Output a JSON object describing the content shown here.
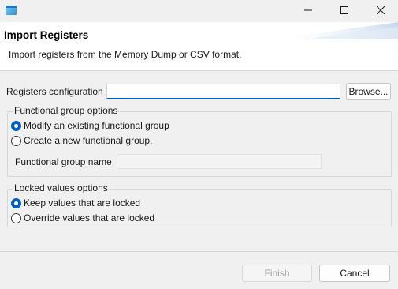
{
  "window": {
    "minimize_icon": "minimize-icon",
    "maximize_icon": "maximize-icon",
    "close_icon": "close-icon",
    "app_icon": "app-window-icon"
  },
  "banner": {
    "title": "Import Registers",
    "description": "Import registers from the Memory Dump or CSV format."
  },
  "config": {
    "label": "Registers configuration",
    "value": "",
    "browse_label": "Browse..."
  },
  "functional_group": {
    "legend": "Functional group options",
    "options": [
      {
        "label": "Modify an existing functional group",
        "checked": true
      },
      {
        "label": "Create a new functional group.",
        "checked": false
      }
    ],
    "name_label": "Functional group name",
    "name_value": ""
  },
  "locked_values": {
    "legend": "Locked values options",
    "options": [
      {
        "label": "Keep values that are locked",
        "checked": true
      },
      {
        "label": "Override values that are locked",
        "checked": false
      }
    ]
  },
  "footer": {
    "finish_label": "Finish",
    "cancel_label": "Cancel"
  },
  "colors": {
    "accent": "#0060c0",
    "banner_bg": "#ffffff",
    "dialog_bg": "#f0f0f0"
  }
}
